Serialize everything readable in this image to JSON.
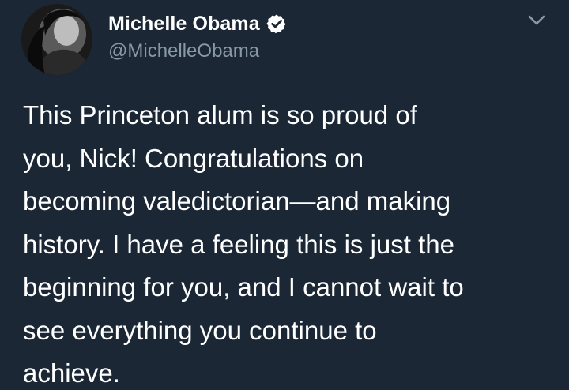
{
  "author": {
    "display_name": "Michelle Obama",
    "handle": "@MichelleObama",
    "verified": true,
    "avatar": "profile-photo-silhouette"
  },
  "tweet": {
    "text": "This Princeton alum is so proud of\nyou, Nick! Congratulations on\nbecoming valedictorian—and making\nhistory. I have a feeling this is just the\nbeginning for you, and I cannot wait to\nsee everything you continue to\nachieve."
  },
  "icons": {
    "verified": "verified-badge-icon",
    "menu": "chevron-down-icon"
  },
  "colors": {
    "background": "#1b2735",
    "text_primary": "#ffffff",
    "text_secondary": "#8899a6"
  }
}
